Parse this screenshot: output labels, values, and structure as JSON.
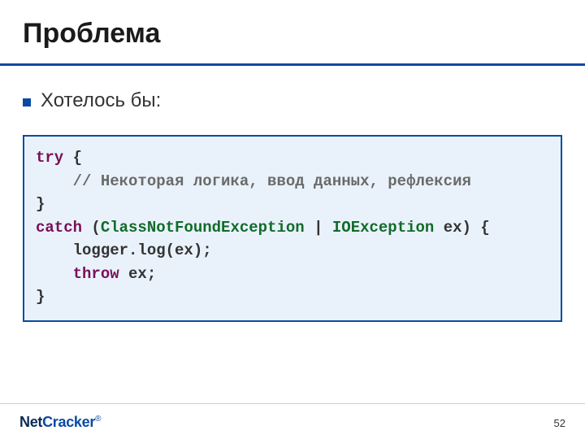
{
  "title": "Проблема",
  "bullet": "Хотелось бы:",
  "code": {
    "l1a": "try",
    "l1b": " {",
    "l2a": "    ",
    "l2b": "// Некоторая логика, ввод данных, рефлексия",
    "l3": "}",
    "l4a": "catch",
    "l4b": " (",
    "l4c": "ClassNotFoundException",
    "l4d": " | ",
    "l4e": "IOException",
    "l4f": " ex) {",
    "l5": "    logger.log(ex);",
    "l6a": "    ",
    "l6b": "throw",
    "l6c": " ex;",
    "l7": "}"
  },
  "logo": {
    "net": "Net",
    "cracker": "Cracker",
    "reg": "®"
  },
  "page_number": "52"
}
